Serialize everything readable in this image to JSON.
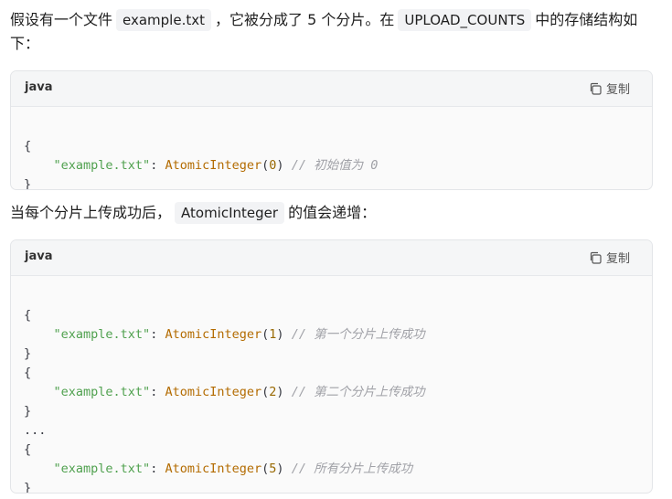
{
  "intro": {
    "text_1": "假设有一个文件",
    "code_1": "example.txt",
    "text_2": "，它被分成了 5 个分片。在",
    "code_2": "UPLOAD_COUNTS",
    "text_3": "中的存储结构如下："
  },
  "block_1": {
    "language": "java",
    "copy_label": "复制",
    "open_brace": "{",
    "close_brace": "}",
    "entry": {
      "key": "\"example.txt\"",
      "colon": ": ",
      "class_name": "AtomicInteger",
      "lparen": "(",
      "value": "0",
      "rparen": ")",
      "comment": "// 初始值为 0"
    }
  },
  "middle": {
    "text_1": "当每个分片上传成功后，",
    "code_1": "AtomicInteger",
    "text_2": "的值会递增："
  },
  "block_2": {
    "language": "java",
    "copy_label": "复制",
    "open_brace": "{",
    "close_brace": "}",
    "ellipsis": "...",
    "entries": [
      {
        "key": "\"example.txt\"",
        "colon": ": ",
        "class_name": "AtomicInteger",
        "lparen": "(",
        "value": "1",
        "rparen": ")",
        "comment": "// 第一个分片上传成功"
      },
      {
        "key": "\"example.txt\"",
        "colon": ": ",
        "class_name": "AtomicInteger",
        "lparen": "(",
        "value": "2",
        "rparen": ")",
        "comment": "// 第二个分片上传成功"
      },
      {
        "key": "\"example.txt\"",
        "colon": ": ",
        "class_name": "AtomicInteger",
        "lparen": "(",
        "value": "5",
        "rparen": ")",
        "comment": "// 所有分片上传成功"
      }
    ]
  },
  "icons": {
    "copy": "copy-icon"
  },
  "colors": {
    "string": "#50a14f",
    "class": "#b36b00",
    "comment": "#a0a1a7",
    "inline_code_bg": "#f2f3f5"
  }
}
